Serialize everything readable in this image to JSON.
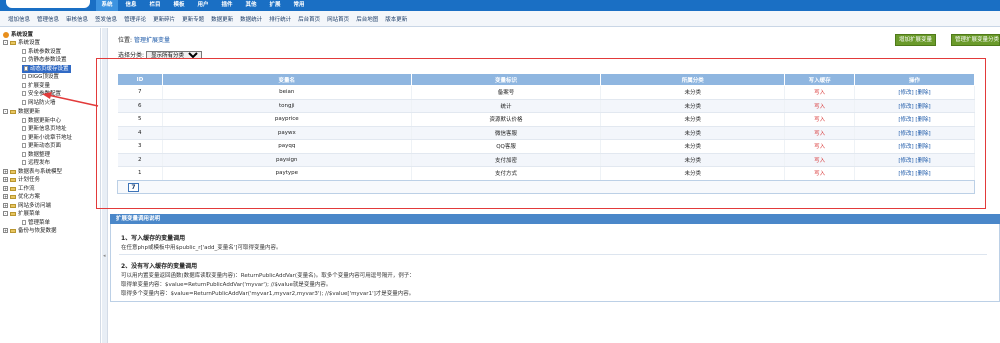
{
  "topnav": [
    "系统",
    "信息",
    "栏目",
    "模板",
    "用户",
    "插件",
    "其他",
    "扩展",
    "常用"
  ],
  "subnav": [
    "增加信息",
    "管理信息",
    "审核信息",
    "签发信息",
    "管理评论",
    "更新碎片",
    "更新专题",
    "数据更新",
    "数据统计",
    "排行统计",
    "后台首页",
    "网站首页",
    "后台地图",
    "版本更新"
  ],
  "sidebar": {
    "root": "系统设置",
    "items": [
      {
        "label": "系统设置",
        "level": 1
      },
      {
        "label": "系统参数设置",
        "level": 2
      },
      {
        "label": "伪静态参数设置",
        "level": 2
      },
      {
        "label": "动态页缓存设置",
        "level": 2
      },
      {
        "label": "DIGG顶设置",
        "level": 2
      },
      {
        "label": "扩展变量",
        "level": 2
      },
      {
        "label": "安全参数配置",
        "level": 2
      },
      {
        "label": "网站防火墙",
        "level": 2
      },
      {
        "label": "数据更新",
        "level": 1
      },
      {
        "label": "数据更新中心",
        "level": 2
      },
      {
        "label": "更新信息页地址",
        "level": 2
      },
      {
        "label": "更新小说章节地址",
        "level": 2
      },
      {
        "label": "更新动态页面",
        "level": 2
      },
      {
        "label": "数据整理",
        "level": 2
      },
      {
        "label": "远程发布",
        "level": 2
      },
      {
        "label": "数据表与系统模型",
        "level": 1
      },
      {
        "label": "计划任务",
        "level": 1
      },
      {
        "label": "工作流",
        "level": 1
      },
      {
        "label": "优化方案",
        "level": 1
      },
      {
        "label": "网站多访问端",
        "level": 1
      },
      {
        "label": "扩展菜单",
        "level": 1
      },
      {
        "label": "管理菜单",
        "level": 2
      },
      {
        "label": "备份与恢复数据",
        "level": 1
      }
    ]
  },
  "location": {
    "prefix": "位置:",
    "link": "管理扩展变量"
  },
  "buttons": {
    "add": "增加扩展变量",
    "manage_cat": "管理扩展变量分类"
  },
  "filter": {
    "label": "选择分类:",
    "selected": "显示所有分类"
  },
  "table": {
    "headers": [
      "ID",
      "变量名",
      "变量标识",
      "所属分类",
      "写入缓存",
      "操作"
    ],
    "rows": [
      {
        "id": "7",
        "name": "beian",
        "label": "备案号",
        "cat": "未分类",
        "cache": "写入",
        "op": "[修改] [删除]"
      },
      {
        "id": "6",
        "name": "tongji",
        "label": "统计",
        "cat": "未分类",
        "cache": "写入",
        "op": "[修改] [删除]"
      },
      {
        "id": "5",
        "name": "payprice",
        "label": "资源默认价格",
        "cat": "未分类",
        "cache": "写入",
        "op": "[修改] [删除]"
      },
      {
        "id": "4",
        "name": "paywx",
        "label": "微信客服",
        "cat": "未分类",
        "cache": "写入",
        "op": "[修改] [删除]"
      },
      {
        "id": "3",
        "name": "payqq",
        "label": "QQ客服",
        "cat": "未分类",
        "cache": "写入",
        "op": "[修改] [删除]"
      },
      {
        "id": "2",
        "name": "paysign",
        "label": "支付加密",
        "cat": "未分类",
        "cache": "写入",
        "op": "[修改] [删除]"
      },
      {
        "id": "1",
        "name": "paytype",
        "label": "支付方式",
        "cat": "未分类",
        "cache": "写入",
        "op": "[修改] [删除]"
      }
    ],
    "page": "7"
  },
  "help": {
    "title": "扩展变量调用说明",
    "h1": "1、写入缓存的变量调用",
    "t1": "在任意php或模板中用$public_r['add_变量名']可取得变量内容。",
    "h2": "2、没有写入缓存的变量调用",
    "t2": "可以用内置变量返回函数(数据库读取变量内容)：ReturnPublicAddVar(变量名)。取多个变量内容可用逗号隔开，例子：",
    "t3": "取得单变量内容：$value=ReturnPublicAddVar('myvar'); //$value就是变量内容。",
    "t4": "取得多个变量内容：$value=ReturnPublicAddVar('myvar1,myvar2,myvar3'); //$value['myvar1']才是变量内容。"
  },
  "colors": {
    "topbar": "#1a6fc4",
    "header": "#8fb6e0",
    "green": "#6a9a2a",
    "red": "#e23a3a"
  }
}
